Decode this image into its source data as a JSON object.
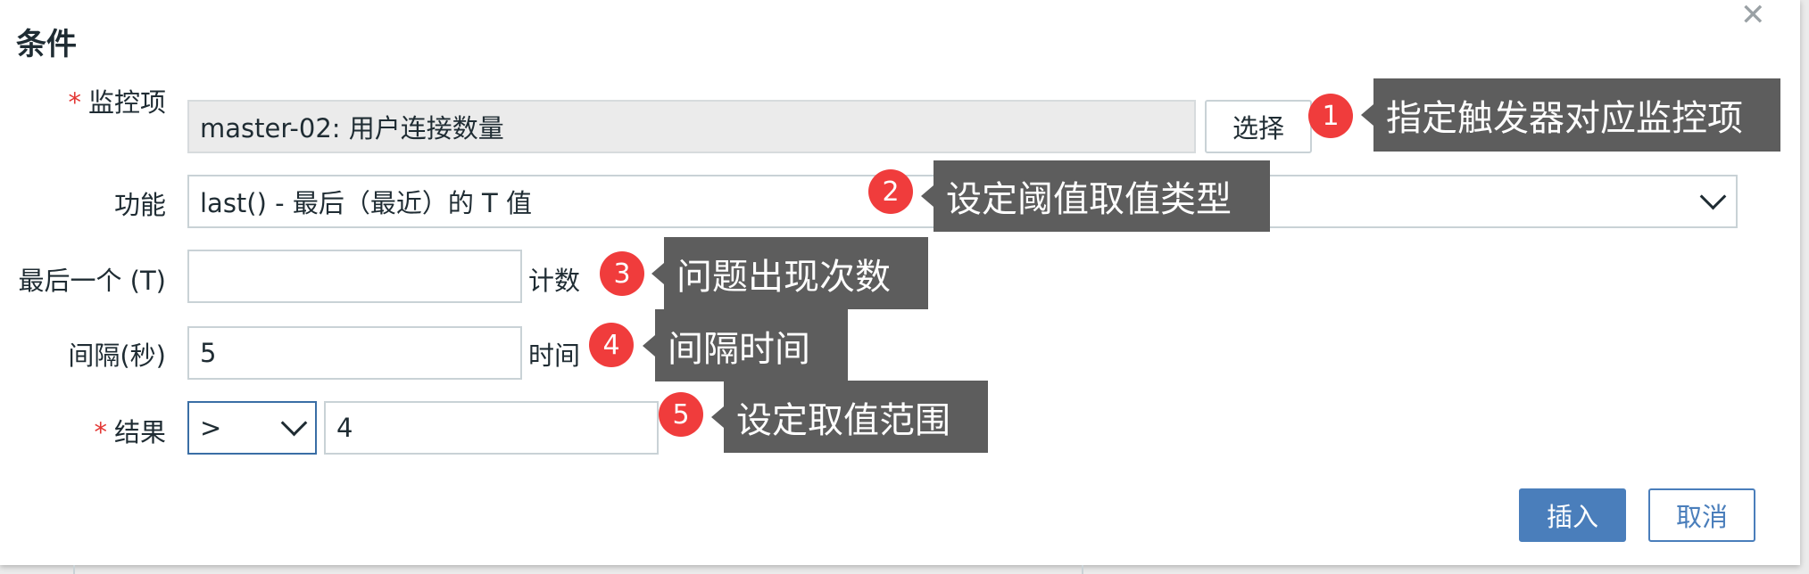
{
  "dialog": {
    "title": "条件",
    "close_glyph": "✕"
  },
  "form": {
    "item": {
      "required_mark": "*",
      "label": "监控项",
      "value": "master-02: 用户连接数量",
      "select_label": "选择"
    },
    "function": {
      "label": "功能",
      "value": "last() - 最后（最近）的 T 值"
    },
    "last_t": {
      "label": "最后一个 (T)",
      "value": "",
      "unit": "计数"
    },
    "interval": {
      "label": "间隔(秒)",
      "value": "5",
      "unit": "时间"
    },
    "result": {
      "required_mark": "*",
      "label": "结果",
      "operator": ">",
      "value": "4"
    }
  },
  "annotations": [
    {
      "number": "1",
      "text": "指定触发器对应监控项"
    },
    {
      "number": "2",
      "text": "设定阈值取值类型"
    },
    {
      "number": "3",
      "text": "问题出现次数"
    },
    {
      "number": "4",
      "text": "间隔时间"
    },
    {
      "number": "5",
      "text": "设定取值范围"
    }
  ],
  "footer": {
    "insert_label": "插入",
    "cancel_label": "取消"
  },
  "colors": {
    "primary": "#4a7ebb",
    "badge": "#f03c3c",
    "tooltip": "#5d5d5d",
    "required": "#e33734"
  }
}
